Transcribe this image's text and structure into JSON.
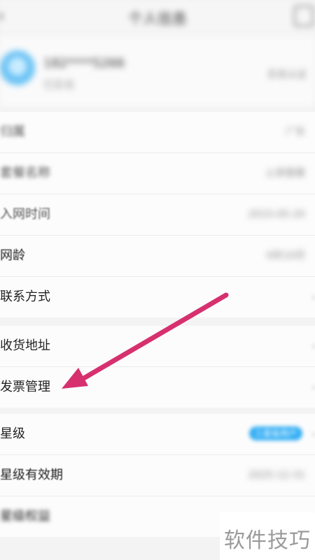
{
  "header": {
    "title": "个人信息"
  },
  "profile": {
    "phone": "182****5266",
    "subtitle": "已实名",
    "registered": "实名认证"
  },
  "groups": [
    {
      "items": [
        {
          "label": "归属",
          "value": "广东"
        },
        {
          "label": "套餐名称",
          "value": "心享套餐"
        },
        {
          "label": "入网时间",
          "value": "2015-05-20"
        },
        {
          "label": "网龄",
          "value": "6年10月"
        },
        {
          "label": "联系方式",
          "value": ""
        }
      ]
    },
    {
      "items": [
        {
          "label": "收货地址",
          "value": ""
        },
        {
          "label": "发票管理",
          "value": ""
        }
      ]
    },
    {
      "items": [
        {
          "label": "星级",
          "badge": "三星级用户"
        },
        {
          "label": "星级有效期",
          "value": "2025-12-31"
        },
        {
          "label": "星级权益",
          "value": ""
        }
      ]
    }
  ],
  "watermark": "软件技巧",
  "colors": {
    "arrow": "#d6306f",
    "badge": "#34aef4",
    "avatar": "#6cc3f5"
  }
}
